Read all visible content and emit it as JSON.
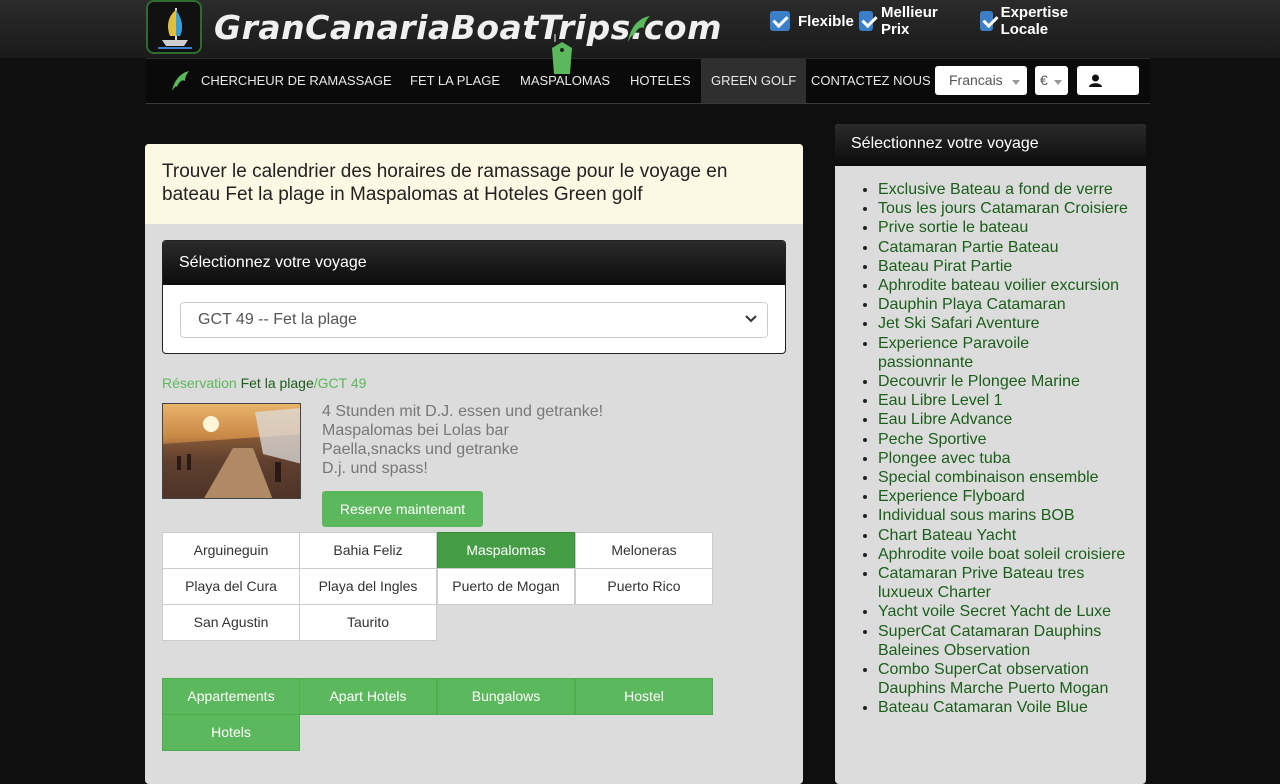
{
  "brand": {
    "name": "GranCanariaBoatTrips.com"
  },
  "features": [
    {
      "label": "Flexible"
    },
    {
      "label": "Mellieur Prix"
    },
    {
      "label": "Expertise Locale"
    }
  ],
  "nav": {
    "items": [
      {
        "label": "CHERCHEUR DE RAMASSAGE"
      },
      {
        "label": "FET LA PLAGE"
      },
      {
        "label": "MASPALOMAS"
      },
      {
        "label": "HOTELES"
      },
      {
        "label": "GREEN GOLF"
      },
      {
        "label": "CONTACTEZ NOUS"
      }
    ],
    "language": "Francais",
    "currency": "€"
  },
  "info": {
    "text": "Trouver le calendrier des horaires de ramassage pour le voyage en bateau Fet la plage in Maspalomas at Hoteles Green golf"
  },
  "trip_select": {
    "heading": "Sélectionnez votre voyage",
    "selected": "GCT 49 -- Fet la plage"
  },
  "breadcrumb": {
    "root": "Réservation",
    "trip": "Fet la plage",
    "code": "/GCT 49"
  },
  "trip": {
    "description": [
      "4 Stunden mit D.J. essen und getranke!",
      "Maspalomas bei Lolas bar",
      "Paella,snacks und getranke",
      "D.j. und spass!"
    ],
    "reserve_label": "Reserve maintenant"
  },
  "locations": [
    "Arguineguin",
    "Bahia Feliz",
    "Maspalomas",
    "Meloneras",
    "Playa del Cura",
    "Playa del Ingles",
    "Puerto de Mogan",
    "Puerto Rico",
    "San Agustin",
    "Taurito"
  ],
  "accommodation_types": [
    "Appartements",
    "Apart Hotels",
    "Bungalows",
    "Hostel",
    "Hotels"
  ],
  "sidebar": {
    "heading": "Sélectionnez votre voyage",
    "trips": [
      "Exclusive Bateau a fond de verre",
      "Tous les jours Catamaran Croisiere",
      "Prive sortie le bateau",
      "Catamaran Partie Bateau",
      "Bateau Pirat Partie",
      "Aphrodite bateau voilier excursion",
      "Dauphin Playa Catamaran",
      "Jet Ski Safari Aventure",
      "Experience Paravoile passionnante",
      "Decouvrir le Plongee Marine",
      "Eau Libre Level 1",
      "Eau Libre Advance",
      "Peche Sportive",
      "Plongee avec tuba",
      "Special combinaison ensemble",
      "Experience Flyboard",
      "Individual sous marins BOB",
      "Chart Bateau Yacht",
      "Aphrodite voile boat soleil croisiere",
      "Catamaran Prive Bateau tres luxueux Charter",
      "Yacht voile Secret Yacht de Luxe",
      "SuperCat Catamaran Dauphins Baleines Observation",
      "Combo SuperCat observation Dauphins Marche Puerto Mogan",
      "Bateau Catamaran Voile Blue"
    ]
  },
  "colors": {
    "accent_green": "#5cb85c",
    "active_green": "#449d44",
    "link_green": "#1a5e1a",
    "checkbox_blue": "#3a7fc8",
    "info_bg": "#fcf8e3"
  }
}
